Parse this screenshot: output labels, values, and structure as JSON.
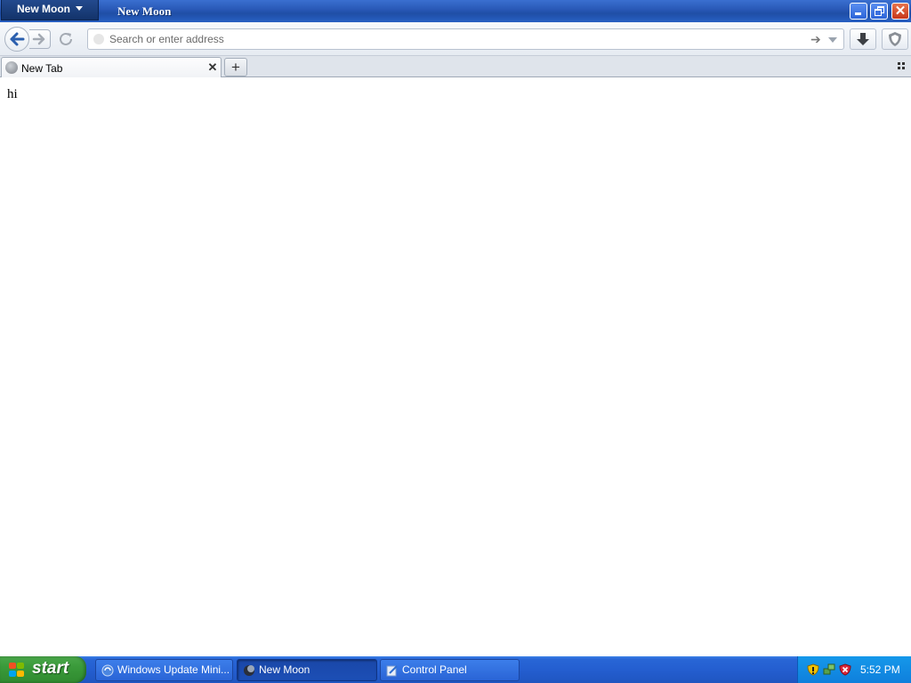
{
  "window": {
    "app_menu_label": "New Moon",
    "title": "New Moon"
  },
  "navbar": {
    "url_placeholder": "Search or enter address",
    "url_value": ""
  },
  "tabs": [
    {
      "label": "New Tab",
      "active": true
    }
  ],
  "content": {
    "text": "hi"
  },
  "taskbar": {
    "start_label": "start",
    "tasks": [
      {
        "label": "Windows Update Mini...",
        "icon": "windows-update-icon",
        "active": false
      },
      {
        "label": "New Moon",
        "icon": "new-moon-icon",
        "active": true
      },
      {
        "label": "Control Panel",
        "icon": "control-panel-icon",
        "active": false
      }
    ],
    "tray_icons": [
      "security-shield-icon",
      "network-icon",
      "security-alert-icon"
    ],
    "clock": "5:52 PM"
  },
  "colors": {
    "titlebar": "#2a5ab8",
    "taskbar": "#245ed0",
    "start_button": "#3a9a3a",
    "close_button": "#c6371b"
  }
}
